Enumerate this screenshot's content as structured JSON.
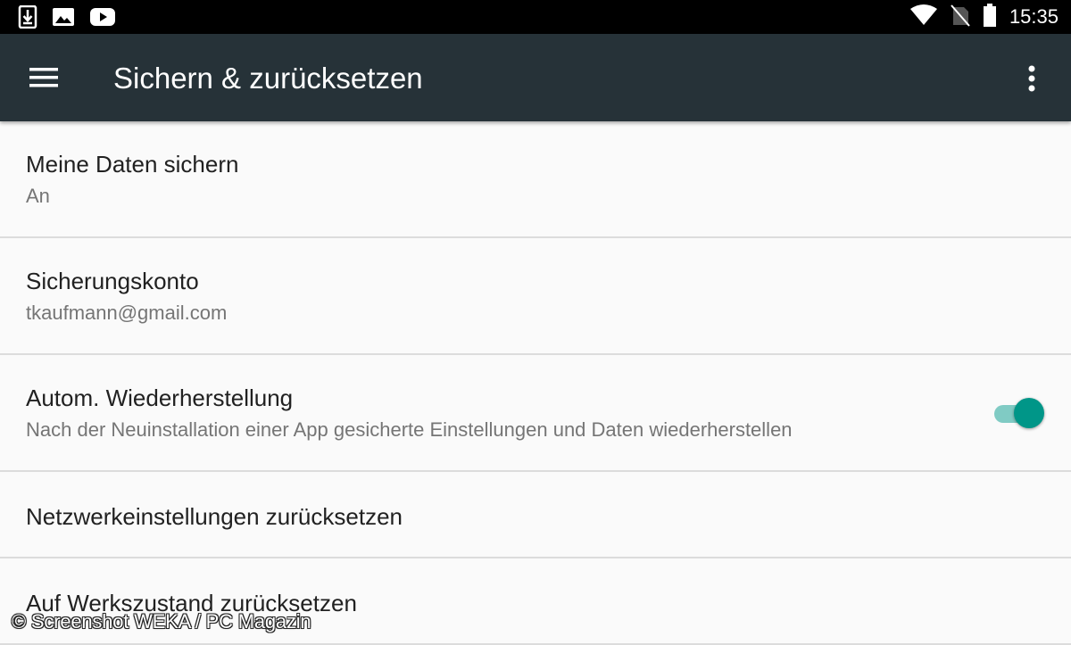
{
  "status_bar": {
    "time": "15:35",
    "left_icons": [
      "download-icon",
      "image-icon",
      "youtube-icon"
    ],
    "right_icons": [
      "wifi-icon",
      "no-sim-icon",
      "battery-icon"
    ]
  },
  "toolbar": {
    "title": "Sichern & zurücksetzen",
    "background": "#263238"
  },
  "items": [
    {
      "title": "Meine Daten sichern",
      "subtitle": "An"
    },
    {
      "title": "Sicherungskonto",
      "subtitle": "tkaufmann@gmail.com"
    },
    {
      "title": "Autom. Wiederherstellung",
      "subtitle": "Nach der Neuinstallation einer App gesicherte Einstellungen und Daten wiederherstellen",
      "toggle": true
    },
    {
      "title": "Netzwerkeinstellungen zurücksetzen"
    },
    {
      "title": "Auf Werkszustand zurücksetzen"
    }
  ],
  "accent_color": "#009688",
  "watermark": "© Screenshot WEKA / PC Magazin"
}
